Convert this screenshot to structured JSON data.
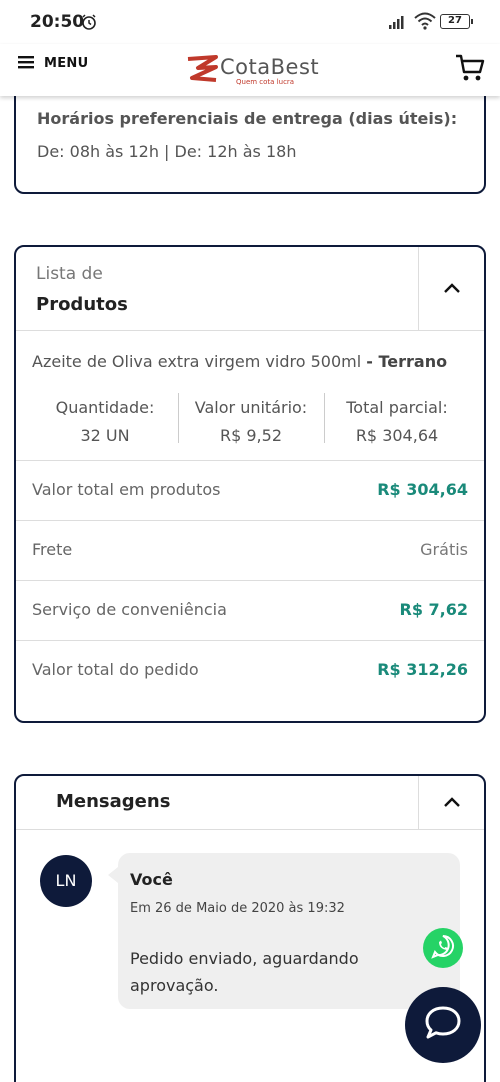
{
  "status": {
    "time": "20:50",
    "battery": "27"
  },
  "header": {
    "menu_label": "MENU",
    "logo_name": "CotaBest",
    "logo_tagline": "Quem cota lucra",
    "cart_icon": "cart-icon"
  },
  "delivery": {
    "title": "Horários preferenciais de entrega (dias úteis):",
    "hours": "De: 08h às 12h | De: 12h às 18h"
  },
  "products": {
    "header_sub": "Lista de",
    "header_title": "Produtos",
    "item": {
      "name": "Azeite de Oliva extra virgem vidro 500ml",
      "brand": "- Terrano",
      "quantity_label": "Quantidade:",
      "quantity": "32 UN",
      "unit_label": "Valor unitário:",
      "unit_value": "R$ 9,52",
      "partial_label": "Total parcial:",
      "partial_value": "R$ 304,64"
    },
    "summary": [
      {
        "label": "Valor total em produtos",
        "value": "R$ 304,64"
      },
      {
        "label": "Frete",
        "value": "Grátis"
      },
      {
        "label": "Serviço de conveniência",
        "value": "R$ 7,62"
      },
      {
        "label": "Valor total do pedido",
        "value": "R$ 312,26"
      }
    ]
  },
  "messages": {
    "title": "Mensagens",
    "items": [
      {
        "avatar": "LN",
        "author": "Você",
        "date": "Em 26 de Maio de 2020 às 19:32",
        "text": "Pedido enviado, aguardando aprovação."
      }
    ]
  },
  "colors": {
    "navy": "#0e1a3a",
    "accent": "#1a8a7a",
    "whatsapp": "#25d366",
    "brand_red": "#c0392b"
  }
}
